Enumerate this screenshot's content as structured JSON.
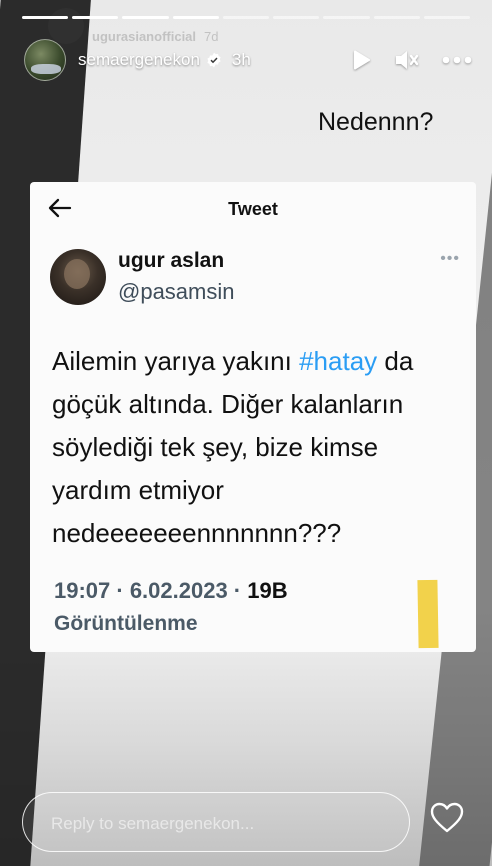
{
  "progress": [
    {
      "fill": 1.0
    },
    {
      "fill": 1.0
    },
    {
      "fill": 1.0
    },
    {
      "fill": 1.0
    },
    {
      "fill": 0.0
    },
    {
      "fill": 0.0
    },
    {
      "fill": 0.0
    },
    {
      "fill": 0.0
    },
    {
      "fill": 0.0
    }
  ],
  "previous_story": {
    "username": "ugurasianofficial",
    "time": "7d"
  },
  "header": {
    "username": "semaergenekon",
    "verified": true,
    "time": "3h",
    "icons": [
      "play-icon",
      "mute-icon",
      "more-icon"
    ]
  },
  "caption": "Nedennn?",
  "tweet": {
    "header_title": "Tweet",
    "display_name": "ugur aslan",
    "handle": "@pasamsin",
    "text_before": "Ailemin yarıya yakını ",
    "hashtag": "#hatay",
    "text_after": " da göçük altında. Diğer kalanların söylediği tek şey, bize kimse yardım etmiyor nedeeeeeeennnnnnn???",
    "time": "19:07 · 6.02.2023 · ",
    "views_count": "19B",
    "views_label": "Görüntülenme"
  },
  "reply": {
    "placeholder": "Reply to semaergenekon..."
  },
  "colors": {
    "hashtag": "#2a9df4",
    "highlight": "#f2d24b"
  }
}
